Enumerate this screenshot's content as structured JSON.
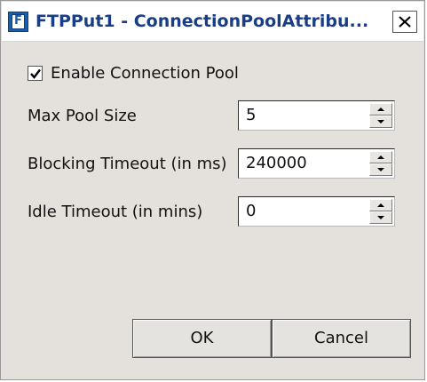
{
  "window": {
    "title": "FTPPut1 - ConnectionPoolAttribu...",
    "icon": "app-icon",
    "icon_glyph": "F",
    "close_icon": "close-icon"
  },
  "checkbox": {
    "label": "Enable Connection Pool",
    "checked": true
  },
  "fields": [
    {
      "label": "Max Pool Size",
      "value": "5"
    },
    {
      "label": "Blocking Timeout (in ms)",
      "value": "240000"
    },
    {
      "label": "Idle Timeout (in mins)",
      "value": "0"
    }
  ],
  "buttons": {
    "ok": "OK",
    "cancel": "Cancel"
  },
  "colors": {
    "title_text": "#1a3e86",
    "dialog_background": "#e4e1dc"
  }
}
